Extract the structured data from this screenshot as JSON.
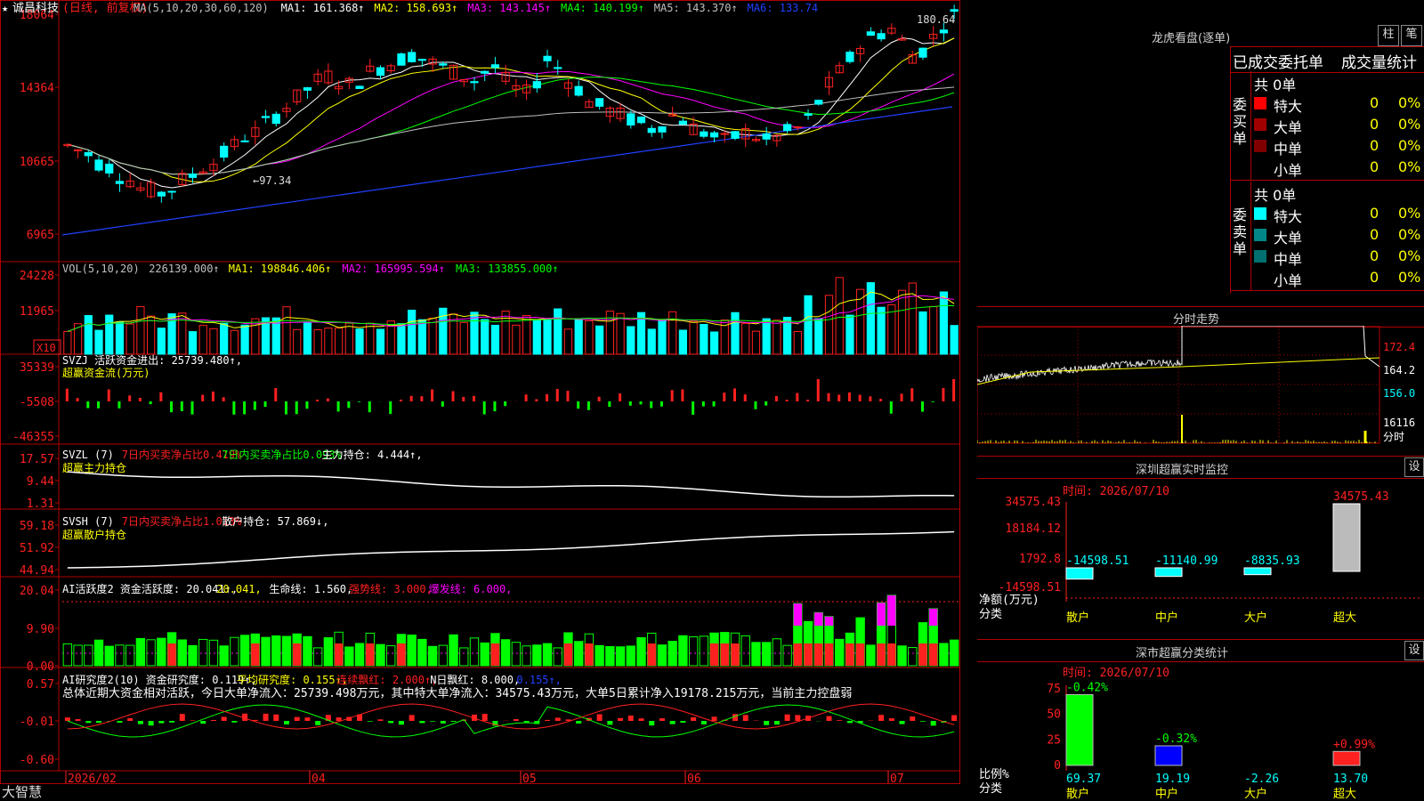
{
  "stock": {
    "star": "★",
    "name": "诚昌科技",
    "mode": "(日线, 前复权)",
    "logo": "大智慧"
  },
  "colors": {
    "up": "#ff2020",
    "down": "#00ffff",
    "ma1": "#ffffff",
    "ma2": "#ffff00",
    "ma3": "#ff00ff",
    "ma4": "#00ff00",
    "ma5": "#c0c0c0",
    "ma6": "#2040ff",
    "grid": "#b00000",
    "buy1": "#ff0000",
    "buy2": "#a00000",
    "buy3": "#800000",
    "sell1": "#00ffff",
    "sell2": "#008888",
    "sell3": "#007070"
  },
  "price_panel": {
    "header": [
      {
        "t": "MA(5,10,20,30,60,120)",
        "c": "#c0c0c0"
      },
      {
        "t": "MA1: 161.368↑",
        "c": "#ffffff"
      },
      {
        "t": "MA2: 158.693↑",
        "c": "#ffff00"
      },
      {
        "t": "MA3: 143.145↑",
        "c": "#ff00ff"
      },
      {
        "t": "MA4: 140.199↑",
        "c": "#00ff00"
      },
      {
        "t": "MA5: 143.370↑",
        "c": "#c0c0c0"
      },
      {
        "t": "MA6: 133.74",
        "c": "#2040ff"
      }
    ],
    "yticks": [
      "18064",
      "14364",
      "10665",
      "6965"
    ],
    "high_label": "180.64",
    "low_label": "←97.34"
  },
  "vol_panel": {
    "header": [
      {
        "t": "VOL(5,10,20)",
        "c": "#c0c0c0"
      },
      {
        "t": "226139.000↑",
        "c": "#c0c0c0"
      },
      {
        "t": "MA1: 198846.406↑",
        "c": "#ffff00"
      },
      {
        "t": "MA2: 165995.594↑",
        "c": "#ff00ff"
      },
      {
        "t": "MA3: 133855.000↑",
        "c": "#00ff00"
      }
    ],
    "yticks": [
      "24228",
      "11965"
    ],
    "unit": "X10"
  },
  "svzj_panel": {
    "header": [
      {
        "t": "SVZJ  活跃资金进出: 25739.480↑,",
        "c": "#ffffff"
      }
    ],
    "sub": "超赢资金流(万元)",
    "yticks": [
      "35339",
      "-5508",
      "-46355"
    ]
  },
  "svzl_panel": {
    "header": [
      {
        "t": "SVZL (7)",
        "c": "#ffffff"
      },
      {
        "t": "7日内买卖净占比0.419%",
        "c": "#ff2020"
      },
      {
        "t": "7日内买卖净占比0.093%",
        "c": "#00ff00"
      },
      {
        "t": "主力持仓: 4.444↑,",
        "c": "#ffffff"
      }
    ],
    "sub": "超赢主力持仓",
    "yticks": [
      "17.57",
      "9.44",
      "1.31"
    ]
  },
  "svsh_panel": {
    "header": [
      {
        "t": "SVSH (7)",
        "c": "#ffffff"
      },
      {
        "t": "7日内买卖净占比1.013%",
        "c": "#ff2020"
      },
      {
        "t": "散户持仓: 57.869↓,",
        "c": "#ffffff"
      }
    ],
    "sub": "超赢散户持仓",
    "yticks": [
      "59.18",
      "51.92",
      "44.94"
    ]
  },
  "ai1_panel": {
    "header": [
      {
        "t": "AI活跃度2 资金活跃度: 20.041↑,",
        "c": "#ffffff"
      },
      {
        "t": "20.041,",
        "c": "#ffff00"
      },
      {
        "t": "生命线: 1.560,",
        "c": "#ffffff"
      },
      {
        "t": "强势线: 3.000,",
        "c": "#ff2020"
      },
      {
        "t": "爆发线: 6.000,",
        "c": "#ff00ff"
      }
    ],
    "yticks": [
      "20.04",
      "9.90",
      "0.00"
    ]
  },
  "ai2_panel": {
    "header": [
      {
        "t": "AI研究度2(10) 资金研究度: 0.119↑,",
        "c": "#ffffff"
      },
      {
        "t": "平均研究度: 0.155↑,",
        "c": "#ffff00"
      },
      {
        "t": "连续飘红: 2.000↑,",
        "c": "#ff2020"
      },
      {
        "t": "N日飘红: 8.000,",
        "c": "#ffffff"
      },
      {
        "t": "0.155↑,",
        "c": "#2040ff"
      }
    ],
    "summary": "总体近期大资金相对活跃，今日大单净流入：25739.498万元，其中特大单净流入：34575.43万元，大单5日累计净入19178.215万元，当前主力控盘弱",
    "yticks": [
      "0.57",
      "-0.01",
      "-0.60"
    ]
  },
  "xaxis": {
    "labels": [
      "2026/02",
      "04",
      "05",
      "06",
      "07"
    ]
  },
  "right": {
    "lhb_title": "龙虎看盘(逐单)",
    "btn_bar": "柱",
    "btn_pen": "笔",
    "tabs": [
      "已成交委托单",
      "成交量统计"
    ],
    "buy": {
      "side": "委买单",
      "total": "共 0单",
      "rows": [
        {
          "name": "特大",
          "v": "0",
          "p": "0%"
        },
        {
          "name": "大单",
          "v": "0",
          "p": "0%"
        },
        {
          "name": "中单",
          "v": "0",
          "p": "0%"
        },
        {
          "name": "小单",
          "v": "0",
          "p": "0%"
        }
      ]
    },
    "sell": {
      "side": "委卖单",
      "total": "共 0单",
      "rows": [
        {
          "name": "特大",
          "v": "0",
          "p": "0%"
        },
        {
          "name": "大单",
          "v": "0",
          "p": "0%"
        },
        {
          "name": "中单",
          "v": "0",
          "p": "0%"
        },
        {
          "name": "小单",
          "v": "0",
          "p": "0%"
        }
      ]
    },
    "fenshi": {
      "title": "分时走势",
      "ticks": [
        "172.4",
        "164.2",
        "156.0"
      ],
      "vol_tick": "16116",
      "vol_unit": "分时"
    },
    "monitor": {
      "title": "深圳超赢实时监控",
      "time": "时间: 2026/07/10",
      "setbtn": "设",
      "yticks": [
        "34575.43",
        "18184.12",
        "1792.8",
        "-14598.51"
      ],
      "ylabel1": "净额(万元)",
      "ylabel2": "分类",
      "cats": [
        "散户",
        "中户",
        "大户",
        "超大"
      ],
      "values": [
        -14598.51,
        -11140.99,
        -8835.93,
        34575.43
      ],
      "value_labels": [
        "-14598.51",
        "-11140.99",
        "-8835.93",
        "34575.43"
      ]
    },
    "classify": {
      "title": "深市超赢分类统计",
      "time": "时间: 2026/07/10",
      "setbtn": "设",
      "yticks": [
        "75",
        "50",
        "25",
        "0"
      ],
      "ylabel1": "比例%",
      "ylabel2": "分类",
      "cats": [
        "散户",
        "中户",
        "大户",
        "超大"
      ],
      "values": [
        69.37,
        19.19,
        -2.26,
        13.7
      ],
      "value_labels": [
        "69.37",
        "19.19",
        "-2.26",
        "13.70"
      ],
      "changes": [
        "-0.42%",
        "-0.32%",
        "",
        "+0.99%"
      ]
    }
  },
  "chart_data": [
    {
      "type": "candlestick",
      "title": "诚昌科技 (日线, 前复权)",
      "ylim": [
        6965,
        18064
      ],
      "high_label": 180.64,
      "low_label": 97.34,
      "x_labels": [
        "2026/02",
        "04",
        "05",
        "06",
        "07"
      ],
      "series": [
        {
          "name": "MA1",
          "value": 161.368
        },
        {
          "name": "MA2",
          "value": 158.693
        },
        {
          "name": "MA3",
          "value": 143.145
        },
        {
          "name": "MA4",
          "value": 140.199
        },
        {
          "name": "MA5",
          "value": 143.37
        },
        {
          "name": "MA6",
          "value": 133.74
        }
      ]
    },
    {
      "type": "bar",
      "title": "VOL(5,10,20)",
      "ylim": [
        0,
        24228
      ],
      "series": [
        {
          "name": "VOL",
          "value": 226139.0
        },
        {
          "name": "MA1",
          "value": 198846.406
        },
        {
          "name": "MA2",
          "value": 165995.594
        },
        {
          "name": "MA3",
          "value": 133855.0
        }
      ]
    },
    {
      "type": "bar",
      "title": "SVZJ",
      "ylim": [
        -46355,
        35339
      ],
      "series": [
        {
          "name": "活跃资金进出",
          "value": 25739.48
        }
      ]
    },
    {
      "type": "line",
      "title": "SVZL (7)",
      "ylim": [
        1.31,
        17.57
      ],
      "series": [
        {
          "name": "主力持仓",
          "value": 4.444
        }
      ]
    },
    {
      "type": "line",
      "title": "SVSH (7)",
      "ylim": [
        44.94,
        59.18
      ],
      "series": [
        {
          "name": "散户持仓",
          "value": 57.869
        }
      ]
    },
    {
      "type": "bar",
      "title": "AI活跃度2",
      "ylim": [
        0,
        20.04
      ],
      "series": [
        {
          "name": "资金活跃度",
          "value": 20.041
        },
        {
          "name": "生命线",
          "value": 1.56
        },
        {
          "name": "强势线",
          "value": 3.0
        },
        {
          "name": "爆发线",
          "value": 6.0
        }
      ]
    },
    {
      "type": "bar",
      "title": "AI研究度2(10)",
      "ylim": [
        -0.6,
        0.57
      ],
      "series": [
        {
          "name": "资金研究度",
          "value": 0.119
        },
        {
          "name": "平均研究度",
          "value": 0.155
        },
        {
          "name": "连续飘红",
          "value": 2.0
        },
        {
          "name": "N日飘红",
          "value": 8.0
        }
      ]
    },
    {
      "type": "bar",
      "title": "深圳超赢实时监控",
      "categories": [
        "散户",
        "中户",
        "大户",
        "超大"
      ],
      "values": [
        -14598.51,
        -11140.99,
        -8835.93,
        34575.43
      ],
      "ylim": [
        -14598.51,
        34575.43
      ]
    },
    {
      "type": "bar",
      "title": "深市超赢分类统计",
      "categories": [
        "散户",
        "中户",
        "大户",
        "超大"
      ],
      "values": [
        69.37,
        19.19,
        -2.26,
        13.7
      ],
      "changes": [
        "-0.42%",
        "-0.32%",
        "",
        "+0.99%"
      ],
      "ylim": [
        0,
        75
      ]
    }
  ]
}
